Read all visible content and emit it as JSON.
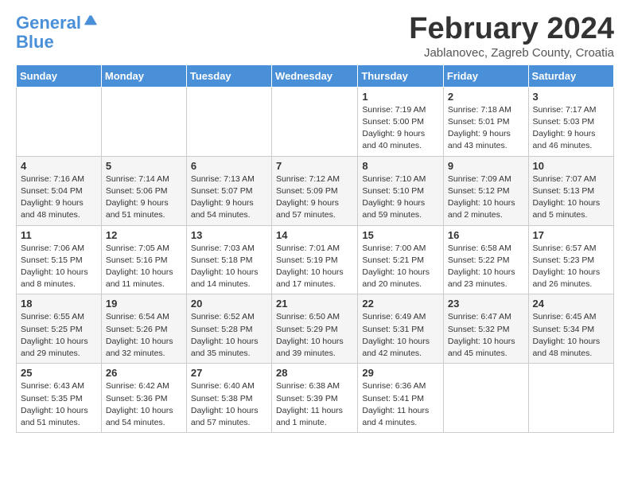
{
  "logo": {
    "line1": "General",
    "line2": "Blue"
  },
  "title": "February 2024",
  "subtitle": "Jablanovec, Zagreb County, Croatia",
  "headers": [
    "Sunday",
    "Monday",
    "Tuesday",
    "Wednesday",
    "Thursday",
    "Friday",
    "Saturday"
  ],
  "weeks": [
    [
      {
        "day": "",
        "info": ""
      },
      {
        "day": "",
        "info": ""
      },
      {
        "day": "",
        "info": ""
      },
      {
        "day": "",
        "info": ""
      },
      {
        "day": "1",
        "info": "Sunrise: 7:19 AM\nSunset: 5:00 PM\nDaylight: 9 hours\nand 40 minutes."
      },
      {
        "day": "2",
        "info": "Sunrise: 7:18 AM\nSunset: 5:01 PM\nDaylight: 9 hours\nand 43 minutes."
      },
      {
        "day": "3",
        "info": "Sunrise: 7:17 AM\nSunset: 5:03 PM\nDaylight: 9 hours\nand 46 minutes."
      }
    ],
    [
      {
        "day": "4",
        "info": "Sunrise: 7:16 AM\nSunset: 5:04 PM\nDaylight: 9 hours\nand 48 minutes."
      },
      {
        "day": "5",
        "info": "Sunrise: 7:14 AM\nSunset: 5:06 PM\nDaylight: 9 hours\nand 51 minutes."
      },
      {
        "day": "6",
        "info": "Sunrise: 7:13 AM\nSunset: 5:07 PM\nDaylight: 9 hours\nand 54 minutes."
      },
      {
        "day": "7",
        "info": "Sunrise: 7:12 AM\nSunset: 5:09 PM\nDaylight: 9 hours\nand 57 minutes."
      },
      {
        "day": "8",
        "info": "Sunrise: 7:10 AM\nSunset: 5:10 PM\nDaylight: 9 hours\nand 59 minutes."
      },
      {
        "day": "9",
        "info": "Sunrise: 7:09 AM\nSunset: 5:12 PM\nDaylight: 10 hours\nand 2 minutes."
      },
      {
        "day": "10",
        "info": "Sunrise: 7:07 AM\nSunset: 5:13 PM\nDaylight: 10 hours\nand 5 minutes."
      }
    ],
    [
      {
        "day": "11",
        "info": "Sunrise: 7:06 AM\nSunset: 5:15 PM\nDaylight: 10 hours\nand 8 minutes."
      },
      {
        "day": "12",
        "info": "Sunrise: 7:05 AM\nSunset: 5:16 PM\nDaylight: 10 hours\nand 11 minutes."
      },
      {
        "day": "13",
        "info": "Sunrise: 7:03 AM\nSunset: 5:18 PM\nDaylight: 10 hours\nand 14 minutes."
      },
      {
        "day": "14",
        "info": "Sunrise: 7:01 AM\nSunset: 5:19 PM\nDaylight: 10 hours\nand 17 minutes."
      },
      {
        "day": "15",
        "info": "Sunrise: 7:00 AM\nSunset: 5:21 PM\nDaylight: 10 hours\nand 20 minutes."
      },
      {
        "day": "16",
        "info": "Sunrise: 6:58 AM\nSunset: 5:22 PM\nDaylight: 10 hours\nand 23 minutes."
      },
      {
        "day": "17",
        "info": "Sunrise: 6:57 AM\nSunset: 5:23 PM\nDaylight: 10 hours\nand 26 minutes."
      }
    ],
    [
      {
        "day": "18",
        "info": "Sunrise: 6:55 AM\nSunset: 5:25 PM\nDaylight: 10 hours\nand 29 minutes."
      },
      {
        "day": "19",
        "info": "Sunrise: 6:54 AM\nSunset: 5:26 PM\nDaylight: 10 hours\nand 32 minutes."
      },
      {
        "day": "20",
        "info": "Sunrise: 6:52 AM\nSunset: 5:28 PM\nDaylight: 10 hours\nand 35 minutes."
      },
      {
        "day": "21",
        "info": "Sunrise: 6:50 AM\nSunset: 5:29 PM\nDaylight: 10 hours\nand 39 minutes."
      },
      {
        "day": "22",
        "info": "Sunrise: 6:49 AM\nSunset: 5:31 PM\nDaylight: 10 hours\nand 42 minutes."
      },
      {
        "day": "23",
        "info": "Sunrise: 6:47 AM\nSunset: 5:32 PM\nDaylight: 10 hours\nand 45 minutes."
      },
      {
        "day": "24",
        "info": "Sunrise: 6:45 AM\nSunset: 5:34 PM\nDaylight: 10 hours\nand 48 minutes."
      }
    ],
    [
      {
        "day": "25",
        "info": "Sunrise: 6:43 AM\nSunset: 5:35 PM\nDaylight: 10 hours\nand 51 minutes."
      },
      {
        "day": "26",
        "info": "Sunrise: 6:42 AM\nSunset: 5:36 PM\nDaylight: 10 hours\nand 54 minutes."
      },
      {
        "day": "27",
        "info": "Sunrise: 6:40 AM\nSunset: 5:38 PM\nDaylight: 10 hours\nand 57 minutes."
      },
      {
        "day": "28",
        "info": "Sunrise: 6:38 AM\nSunset: 5:39 PM\nDaylight: 11 hours\nand 1 minute."
      },
      {
        "day": "29",
        "info": "Sunrise: 6:36 AM\nSunset: 5:41 PM\nDaylight: 11 hours\nand 4 minutes."
      },
      {
        "day": "",
        "info": ""
      },
      {
        "day": "",
        "info": ""
      }
    ]
  ]
}
